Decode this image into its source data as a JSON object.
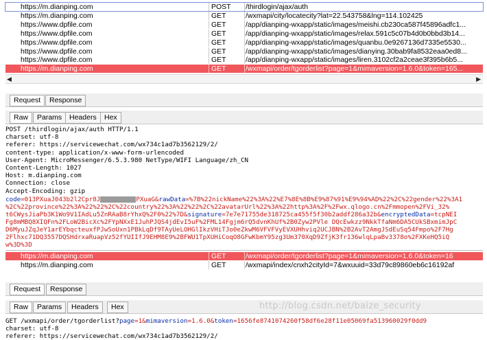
{
  "requests_top": [
    {
      "host": "https://m.dianping.com",
      "method": "POST",
      "url": "/thirdlogin/ajax/auth",
      "selected": false,
      "boxed": true
    },
    {
      "host": "https://m.dianping.com",
      "method": "GET",
      "url": "/wxmapi/city/locatecity?lat=22.543758&lng=114.102425",
      "selected": false
    },
    {
      "host": "https://www.dpfile.com",
      "method": "GET",
      "url": "/app/dianping-wxapp/static/images/meishi.cb230ca587f45896adfc1...",
      "selected": false
    },
    {
      "host": "https://www.dpfile.com",
      "method": "GET",
      "url": "/app/dianping-wxapp/static/images/relax.591c5c07b4d0b0bbd3b14...",
      "selected": false
    },
    {
      "host": "https://www.dpfile.com",
      "method": "GET",
      "url": "/app/dianping-wxapp/static/images/quanbu.0e9267136d7335e5530...",
      "selected": false
    },
    {
      "host": "https://www.dpfile.com",
      "method": "GET",
      "url": "/app/dianping-wxapp/static/images/dianying.30bab9fa8532eaa0ed8...",
      "selected": false
    },
    {
      "host": "https://www.dpfile.com",
      "method": "GET",
      "url": "/app/dianping-wxapp/static/images/liren.3102cf2a2ceae3f395b6b5...",
      "selected": false
    },
    {
      "host": "https://m.dianping.com",
      "method": "GET",
      "url": "/wxmapi/order/tgorderlist?page=1&mimaversion=1.6.0&token=165...",
      "selected": true
    }
  ],
  "tabs_top": {
    "request": "Request",
    "response": "Response"
  },
  "subtabs_top": {
    "raw": "Raw",
    "params": "Params",
    "headers": "Headers",
    "hex": "Hex"
  },
  "raw_top": [
    "POST /thirdlogin/ajax/auth HTTP/1.1",
    "charset: utf-8",
    "referer: https://servicewechat.com/wx734c1ad7b3562129/2/",
    "content-type: application/x-www-form-urlencoded",
    "User-Agent: MicroMessenger/6.5.3.980 NetType/WIFI Language/zh_CN",
    "Content-Length: 1027",
    "Host: m.dianping.com",
    "Connection: close",
    "Accept-Encoding: gzip"
  ],
  "body_top": {
    "l1_key1": "code",
    "l1_val1a": "=013PXuaJ043b2l2Cpr8J",
    "l1_val1b": "PXuaG&",
    "l1_key2": "rawData",
    "l1_val2": "=%7B%22nickName%22%3A%22%E7%8E%8B%E9%87%91%E9%94%AD%22%2C%22gender%22%3A1",
    "l2_a": "%2C%22province%22%3A%22%22%2C%22country%22%3A%22%22%2C%22avatarUrl%22%3A%22http%3A%2F%2Fwx.qlogo.cn%2Fmmopen%2FVi_32%",
    "l3_a": "t6CWysJiaPb3K1Wo9V1IAdLu5ZnRAaB8rYhxQ%2F0%22%7D&",
    "l3_key": "signature",
    "l3_val": "=7e7e71755de318725ca455f5f30b2addf286a32b&",
    "l3_key2": "encryptedData",
    "l3_val2": "=tcpNEI",
    "l4": "Fg8mMBQ8XIQFn%2FLoW2BicXc%2FYpNXxE1JuhPJQS4jdEvI5uF%2FML14Fgjm6rQ5dvnKhUf%2B0Zyw2PVle DQcEwkzz9NkkTfaNm6DA5CUkSBxmimJpC",
    "l5": "D6MyuJZqJeY1arEYbqcteuxfPJwSoUxn1PBkLqDf9TAyUeLOHGlIkzVHiTJo0eZkwM6VFVFVyEVXUHhviq2UCJBN%2B2AvT2AmgJSdEuSq54Fmpo%2F7Hg",
    "l6": "2Flhxc71DQ3557DQSHdrxaRuapVz52fYUIIfJ9EHM8E9%2BFWU1TpXUHiCoqO8GFwKbmY95zg3Um370XqD9ZfjK3fr136wlqLpaBv3378o%2FXKeHQ5iQ",
    "l7": "w%3D%3D"
  },
  "requests_bottom": [
    {
      "host": "https://m.dianping.com",
      "method": "GET",
      "url": "/wxmapi/order/tgorderlist?page=1&mimaversion=1.6.0&token=16",
      "selected": true
    },
    {
      "host": "https://m.dianping.com",
      "method": "GET",
      "url": "/wxmapi/index/cnxh2cityId=7&wxuuid=33d79c89860eb6c16192af",
      "selected": false
    }
  ],
  "tabs_bottom": {
    "request": "Request",
    "response": "Response"
  },
  "subtabs_bottom": {
    "raw": "Raw",
    "params": "Params",
    "headers": "Headers",
    "hex": "Hex"
  },
  "raw_bottom": {
    "l1_pre": "GET /wxmapi/order/tgorderlist?",
    "l1_k1": "page",
    "l1_v1": "=1&",
    "l1_k2": "mimaversion",
    "l1_v2": "=1.6.0&",
    "l1_k3": "token",
    "l1_v3": "=1656fe8741074260f58df6e28f11e05069fa513960029f0dd9",
    "l2": "charset: utf-8",
    "l3": "referer: https://servicewechat.com/wx734c1ad7b3562129/2/"
  },
  "watermark": "http://blog.csdn.net/baize_security",
  "colors": {
    "selected_row": "#f0575b",
    "param_key": "#0a2ea8",
    "param_value": "#c81a14"
  }
}
